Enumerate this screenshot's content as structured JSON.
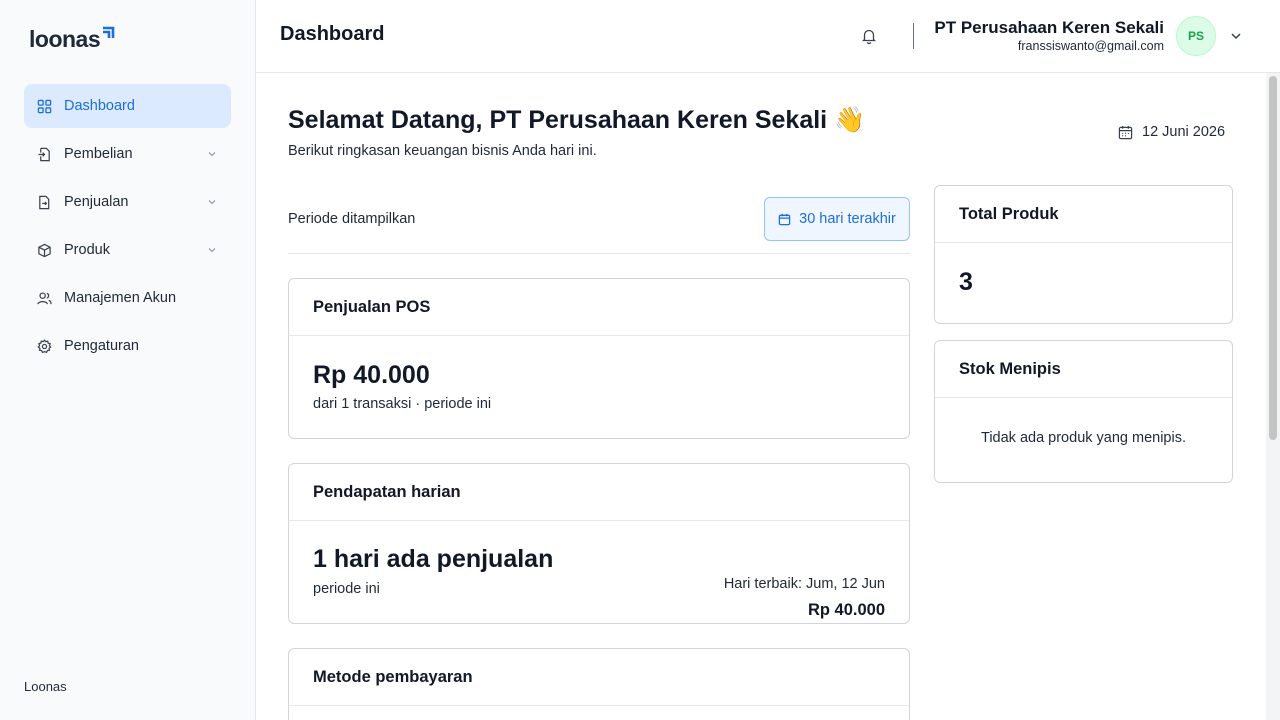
{
  "app": {
    "logo_text": "loonas",
    "footer": "Loonas"
  },
  "sidebar": {
    "items": [
      {
        "label": "Dashboard",
        "icon": "grid-icon",
        "active": true
      },
      {
        "label": "Pembelian",
        "icon": "file-import-icon",
        "has_submenu": true
      },
      {
        "label": "Penjualan",
        "icon": "file-export-icon",
        "has_submenu": true
      },
      {
        "label": "Produk",
        "icon": "box-icon",
        "has_submenu": true
      },
      {
        "label": "Manajemen Akun",
        "icon": "users-icon"
      },
      {
        "label": "Pengaturan",
        "icon": "gear-icon"
      }
    ]
  },
  "header": {
    "title": "Dashboard",
    "user_name": "PT Perusahaan Keren Sekali",
    "user_email": "franssiswanto@gmail.com",
    "avatar_initials": "PS"
  },
  "main": {
    "welcome": "Selamat Datang, PT Perusahaan Keren Sekali 👋",
    "subtitle": "Berikut ringkasan keuangan bisnis Anda hari ini.",
    "date": "12 Juni 2026",
    "period_label": "Periode ditampilkan",
    "period_button": "30 hari terakhir",
    "pos_card": {
      "title": "Penjualan POS",
      "value": "Rp 40.000",
      "caption": "dari 1 transaksi · periode ini"
    },
    "daily_card": {
      "title": "Pendapatan harian",
      "value": "1 hari ada penjualan",
      "caption": "periode ini",
      "best_day_label": "Hari terbaik: Jum, 12 Jun",
      "best_day_value": "Rp 40.000"
    },
    "payment_card": {
      "title": "Metode pembayaran"
    },
    "total_products_card": {
      "title": "Total Produk",
      "value": "3"
    },
    "low_stock_card": {
      "title": "Stok Menipis",
      "empty_text": "Tidak ada produk yang menipis."
    }
  },
  "colors": {
    "accent": "#1d6fd8",
    "active_bg": "#dbeafe",
    "avatar_bg": "#dcfce7",
    "avatar_text": "#16a34a"
  }
}
